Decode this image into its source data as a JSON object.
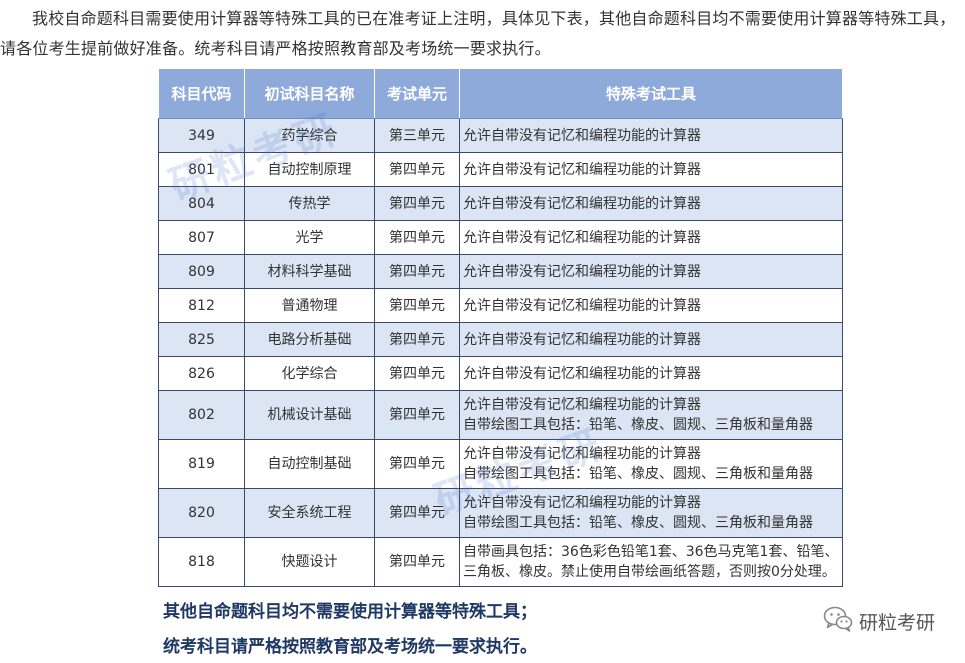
{
  "intro": {
    "text": "我校自命题科目需要使用计算器等特殊工具的已在准考证上注明，具体见下表，其他自命题科目均不需要使用计算器等特殊工具，请各位考生提前做好准备。统考科目请严格按照教育部及考场统一要求执行。"
  },
  "table": {
    "headers": [
      "科目代码",
      "初试科目名称",
      "考试单元",
      "特殊考试工具"
    ],
    "rows": [
      {
        "code": "349",
        "name": "药学综合",
        "unit": "第三单元",
        "tools": [
          "允许自带没有记忆和编程功能的计算器"
        ]
      },
      {
        "code": "801",
        "name": "自动控制原理",
        "unit": "第四单元",
        "tools": [
          "允许自带没有记忆和编程功能的计算器"
        ]
      },
      {
        "code": "804",
        "name": "传热学",
        "unit": "第四单元",
        "tools": [
          "允许自带没有记忆和编程功能的计算器"
        ]
      },
      {
        "code": "807",
        "name": "光学",
        "unit": "第四单元",
        "tools": [
          "允许自带没有记忆和编程功能的计算器"
        ]
      },
      {
        "code": "809",
        "name": "材料科学基础",
        "unit": "第四单元",
        "tools": [
          "允许自带没有记忆和编程功能的计算器"
        ]
      },
      {
        "code": "812",
        "name": "普通物理",
        "unit": "第四单元",
        "tools": [
          "允许自带没有记忆和编程功能的计算器"
        ]
      },
      {
        "code": "825",
        "name": "电路分析基础",
        "unit": "第四单元",
        "tools": [
          "允许自带没有记忆和编程功能的计算器"
        ]
      },
      {
        "code": "826",
        "name": "化学综合",
        "unit": "第四单元",
        "tools": [
          "允许自带没有记忆和编程功能的计算器"
        ]
      },
      {
        "code": "802",
        "name": "机械设计基础",
        "unit": "第四单元",
        "tools": [
          "允许自带没有记忆和编程功能的计算器",
          "自带绘图工具包括：铅笔、橡皮、圆规、三角板和量角器"
        ]
      },
      {
        "code": "819",
        "name": "自动控制基础",
        "unit": "第四单元",
        "tools": [
          "允许自带没有记忆和编程功能的计算器",
          "自带绘图工具包括：铅笔、橡皮、圆规、三角板和量角器"
        ]
      },
      {
        "code": "820",
        "name": "安全系统工程",
        "unit": "第四单元",
        "tools": [
          "允许自带没有记忆和编程功能的计算器",
          "自带绘图工具包括：铅笔、橡皮、圆规、三角板和量角器"
        ]
      },
      {
        "code": "818",
        "name": "快题设计",
        "unit": "第四单元",
        "tools": [
          "自带画具包括：36色彩色铅笔1套、36色马克笔1套、铅笔、",
          "三角板、橡皮。禁止使用自带绘画纸答题，否则按0分处理。"
        ]
      }
    ]
  },
  "footer": {
    "line1": "其他自命题科目均不需要使用计算器等特殊工具；",
    "line2": "统考科目请严格按照教育部及考场统一要求执行。"
  },
  "brand": {
    "name": "研粒考研",
    "icon": "wechat-icon"
  },
  "watermark": {
    "text": "研粒考研"
  },
  "colors": {
    "header_bg": "#8eaadb",
    "stripe_bg": "#dbe5f4",
    "footer_text": "#1f3864"
  }
}
